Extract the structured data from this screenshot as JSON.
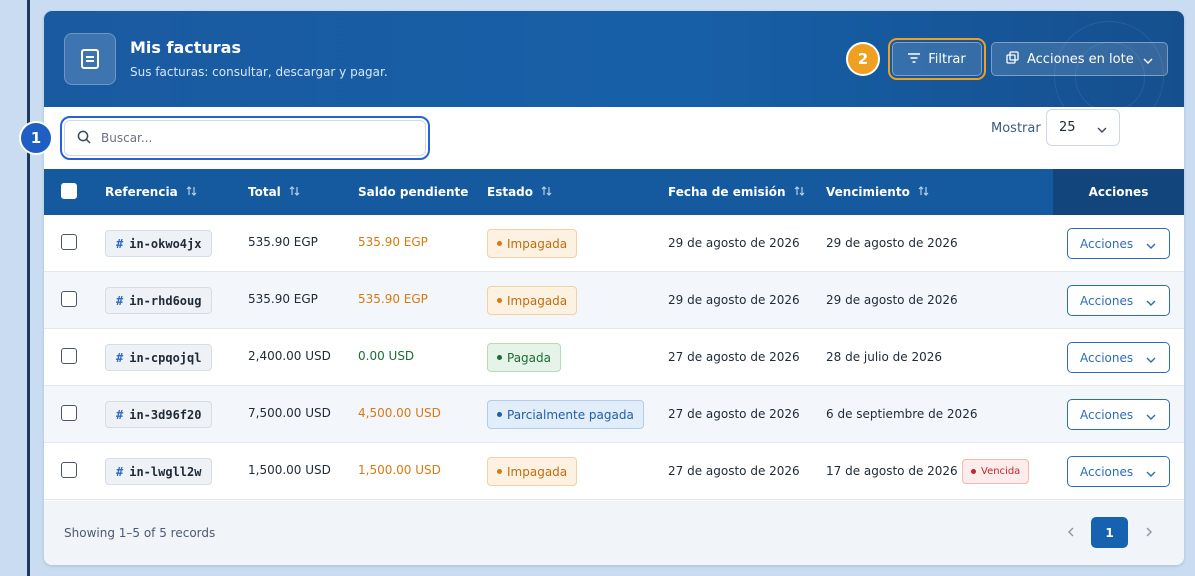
{
  "header": {
    "title": "Mis facturas",
    "subtitle": "Sus facturas: consultar, descargar y pagar.",
    "filter_label": "Filtrar",
    "bulk_label": "Acciones en lote"
  },
  "annotations": {
    "badge1": "1",
    "badge2": "2"
  },
  "toolbar": {
    "search_placeholder": "Buscar...",
    "show_label": "Mostrar",
    "per_page": "25"
  },
  "table": {
    "columns": {
      "ref": "Referencia",
      "total": "Total",
      "balance": "Saldo pendiente",
      "status": "Estado",
      "issued": "Fecha de emisión",
      "due": "Vencimiento",
      "actions": "Acciones"
    },
    "rows": [
      {
        "ref": "in-okwo4jx",
        "total": "535.90 EGP",
        "balance": "535.90 EGP",
        "status": "Impagada",
        "issued": "29 de agosto de 2026",
        "due": "29 de agosto de 2026",
        "actions": "Acciones"
      },
      {
        "ref": "in-rhd6oug",
        "total": "535.90 EGP",
        "balance": "535.90 EGP",
        "status": "Impagada",
        "issued": "29 de agosto de 2026",
        "due": "29 de agosto de 2026",
        "actions": "Acciones"
      },
      {
        "ref": "in-cpqojql",
        "total": "2,400.00 USD",
        "balance": "0.00 USD",
        "status": "Pagada",
        "issued": "27 de agosto de 2026",
        "due": "28 de julio de 2026",
        "actions": "Acciones"
      },
      {
        "ref": "in-3d96f20",
        "total": "7,500.00 USD",
        "balance": "4,500.00 USD",
        "status": "Parcialmente pagada",
        "issued": "27 de agosto de 2026",
        "due": "6 de septiembre de 2026",
        "actions": "Acciones"
      },
      {
        "ref": "in-lwgll2w",
        "total": "1,500.00 USD",
        "balance": "1,500.00 USD",
        "status": "Impagada",
        "issued": "27 de agosto de 2026",
        "due": "17 de agosto de 2026",
        "overdue": "Vencida",
        "actions": "Acciones"
      }
    ]
  },
  "footer": {
    "records_text": "Showing 1–5 of 5 records",
    "current_page": "1"
  },
  "colors": {
    "header_blue": "#1a5aa0",
    "accent_orange": "#f0a020",
    "accent_blue": "#1f5fc4",
    "unpaid": "#d77a10",
    "paid": "#1d6b35",
    "overdue": "#c0262d"
  },
  "icons": [
    "document-icon",
    "filter-icon",
    "copy-icon",
    "chevron-down-icon",
    "search-icon",
    "sort-icon",
    "hash-icon",
    "chevron-left-icon",
    "chevron-right-icon"
  ]
}
